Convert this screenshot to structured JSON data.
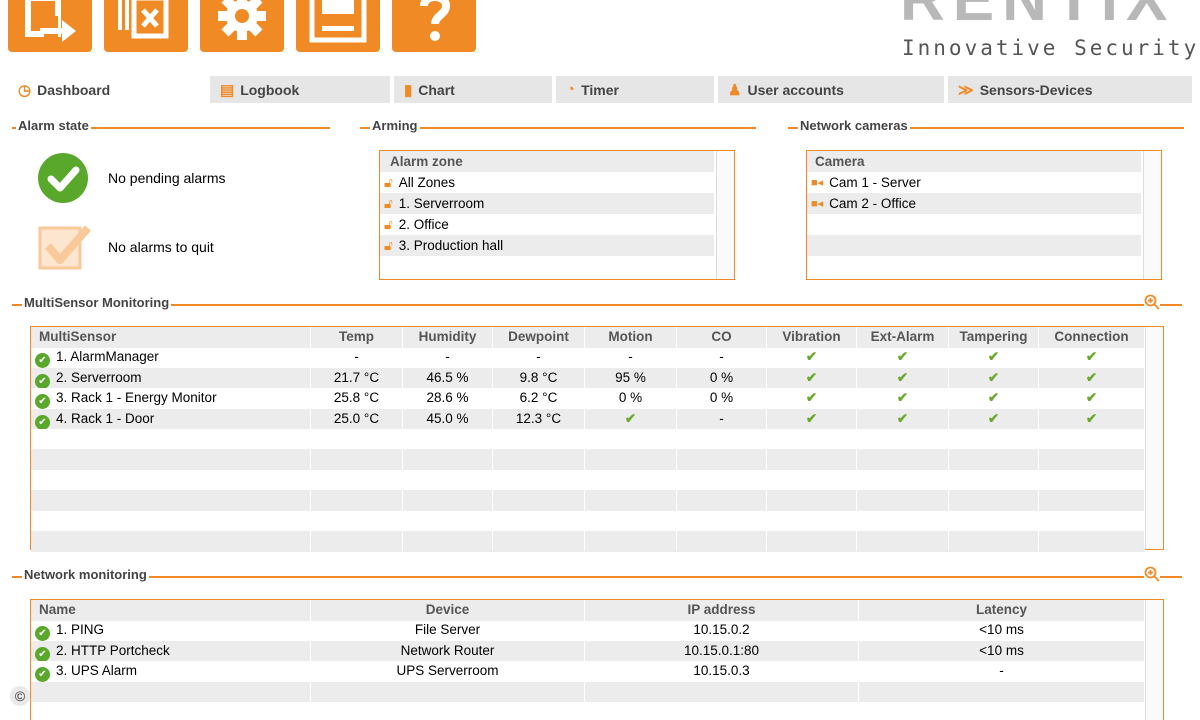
{
  "brand": {
    "logo_text": "RENTIX",
    "tagline": "Innovative Security",
    "accent_color": "#f08a24",
    "ok_color": "#59a82c"
  },
  "toolbar": {
    "buttons": [
      {
        "name": "logout",
        "icon": "exit-icon"
      },
      {
        "name": "clear",
        "icon": "clear-alarm-icon"
      },
      {
        "name": "settings",
        "icon": "gear-icon"
      },
      {
        "name": "save",
        "icon": "save-icon"
      },
      {
        "name": "help",
        "icon": "question-icon"
      }
    ]
  },
  "tabs": [
    {
      "label": "Dashboard",
      "icon": "dashboard-icon",
      "active": true
    },
    {
      "label": "Logbook",
      "icon": "logbook-icon"
    },
    {
      "label": "Chart",
      "icon": "chart-icon"
    },
    {
      "label": "Timer",
      "icon": "timer-icon"
    },
    {
      "label": "User accounts",
      "icon": "users-icon"
    },
    {
      "label": "Sensors-Devices",
      "icon": "sensors-icon"
    }
  ],
  "alarm_state": {
    "title": "Alarm state",
    "pending": "No pending alarms",
    "quit": "No alarms to quit"
  },
  "arming": {
    "title": "Arming",
    "header": "Alarm zone",
    "zones": [
      "All Zones",
      "1. Serverroom",
      "2. Office",
      "3. Production hall"
    ]
  },
  "cameras": {
    "title": "Network cameras",
    "header": "Camera",
    "items": [
      "Cam 1 - Server",
      "Cam 2 - Office"
    ]
  },
  "multisensor": {
    "title": "MultiSensor Monitoring",
    "columns": [
      "MultiSensor",
      "Temp",
      "Humidity",
      "Dewpoint",
      "Motion",
      "CO",
      "Vibration",
      "Ext-Alarm",
      "Tampering",
      "Connection"
    ],
    "rows": [
      [
        "1. AlarmManager",
        "-",
        "-",
        "-",
        "-",
        "-",
        "✔",
        "✔",
        "✔",
        "✔"
      ],
      [
        "2. Serverroom",
        "21.7 °C",
        "46.5 %",
        "9.8 °C",
        "95 %",
        "0 %",
        "✔",
        "✔",
        "✔",
        "✔"
      ],
      [
        "3. Rack 1 - Energy Monitor",
        "25.8 °C",
        "28.6 %",
        "6.2 °C",
        "0 %",
        "0 %",
        "✔",
        "✔",
        "✔",
        "✔"
      ],
      [
        "4. Rack 1 - Door",
        "25.0 °C",
        "45.0 %",
        "12.3 °C",
        "✔",
        "-",
        "✔",
        "✔",
        "✔",
        "✔"
      ]
    ]
  },
  "network": {
    "title": "Network monitoring",
    "columns": [
      "Name",
      "Device",
      "IP address",
      "Latency"
    ],
    "rows": [
      [
        "1. PING",
        "File Server",
        "10.15.0.2",
        "<10 ms"
      ],
      [
        "2. HTTP Portcheck",
        "Network Router",
        "10.15.0.1:80",
        "<10 ms"
      ],
      [
        "3. UPS Alarm",
        "UPS Serverroom",
        "10.15.0.3",
        "-"
      ]
    ]
  },
  "footer": {
    "copyright_symbol": "©"
  }
}
